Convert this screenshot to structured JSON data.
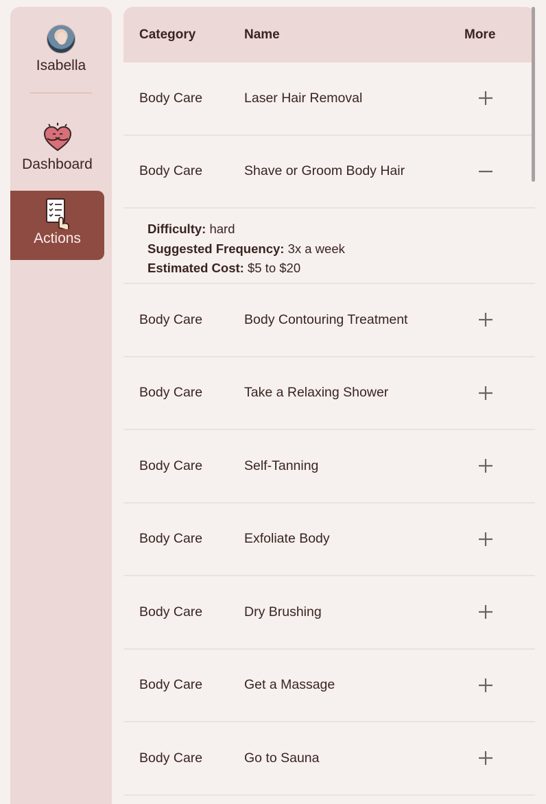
{
  "user": {
    "name": "Isabella"
  },
  "nav": [
    {
      "label": "Dashboard",
      "icon": "heart-hug-icon"
    },
    {
      "label": "Actions",
      "icon": "checklist-hand-icon",
      "active": true
    }
  ],
  "table": {
    "headers": {
      "category": "Category",
      "name": "Name",
      "more": "More"
    },
    "rows": [
      {
        "category": "Body Care",
        "name": "Laser Hair Removal",
        "expanded": false
      },
      {
        "category": "Body Care",
        "name": "Shave or Groom Body Hair",
        "expanded": true
      },
      {
        "category": "Body Care",
        "name": "Body Contouring Treatment",
        "expanded": false
      },
      {
        "category": "Body Care",
        "name": "Take a Relaxing Shower",
        "expanded": false
      },
      {
        "category": "Body Care",
        "name": "Self-Tanning",
        "expanded": false
      },
      {
        "category": "Body Care",
        "name": "Exfoliate Body",
        "expanded": false
      },
      {
        "category": "Body Care",
        "name": "Dry Brushing",
        "expanded": false
      },
      {
        "category": "Body Care",
        "name": "Get a Massage",
        "expanded": false
      },
      {
        "category": "Body Care",
        "name": "Go to Sauna",
        "expanded": false
      }
    ],
    "details": {
      "difficulty_label": "Difficulty:",
      "difficulty": "hard",
      "frequency_label": "Suggested Frequency:",
      "frequency": "3x a week",
      "cost_label": "Estimated Cost:",
      "cost": "$5 to $20"
    }
  },
  "colors": {
    "sidebar_bg": "#ecd8d6",
    "active_nav": "#8e4b42",
    "page_bg": "#f6f1ee",
    "text": "#3a2422"
  }
}
